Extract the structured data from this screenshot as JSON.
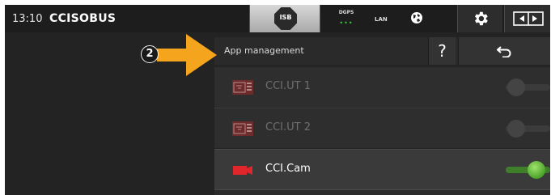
{
  "status_bar": {
    "time": "13:10",
    "brand": "CCISOBUS",
    "isb_label": "ISB",
    "gps_label": "DGPS",
    "gps_dots": "•••",
    "lan_label": "LAN",
    "globe_icon": "globe-icon",
    "settings_icon": "gear-icon",
    "switch_icon": "swap-screens-icon"
  },
  "header": {
    "title": "App management",
    "help_label": "?",
    "back_icon": "return-arrow-icon"
  },
  "apps": [
    {
      "name": "CCI.UT 1",
      "icon": "terminal-icon",
      "enabled": false
    },
    {
      "name": "CCI.UT 2",
      "icon": "terminal-icon",
      "enabled": false
    },
    {
      "name": "CCI.Cam",
      "icon": "camera-icon",
      "enabled": true
    }
  ],
  "annotation": {
    "number": "2",
    "color": "#f5a51d"
  }
}
